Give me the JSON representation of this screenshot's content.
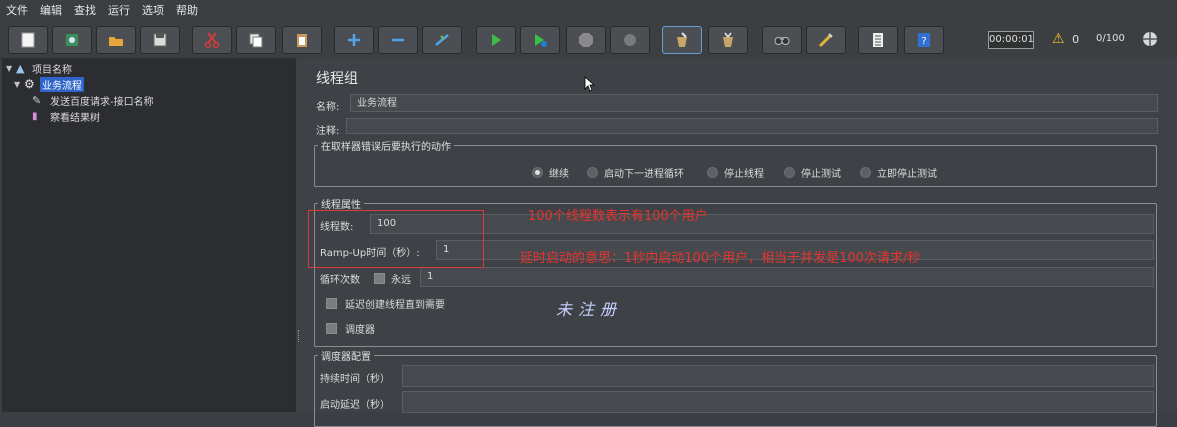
{
  "menu": [
    "文件",
    "编辑",
    "查找",
    "运行",
    "选项",
    "帮助"
  ],
  "toolbar": {
    "timer": "00:00:01",
    "warning_count": "0",
    "threads": "0/100",
    "buttons": [
      "new-icon",
      "templates-icon",
      "open-icon",
      "save-icon",
      "cut-icon",
      "copy-icon",
      "paste-icon",
      "expand-icon",
      "collapse-icon",
      "toggle-icon",
      "start-icon",
      "start-no-pause-icon",
      "stop-icon",
      "shutdown-icon",
      "clear-icon",
      "clear-all-icon",
      "search-icon",
      "reset-search-icon",
      "function-helper-icon",
      "help-icon"
    ]
  },
  "tree": {
    "items": [
      {
        "label": "项目名称",
        "icon": "test-plan-icon"
      },
      {
        "label": "业务流程",
        "icon": "thread-group-gear-icon"
      },
      {
        "label": "发送百度请求-接口名称",
        "icon": "http-sampler-pen-icon"
      },
      {
        "label": "察看结果树",
        "icon": "listener-chart-icon"
      }
    ]
  },
  "panel": {
    "title": "线程组",
    "name_label": "名称:",
    "name_value": "业务流程",
    "comment_label": "注释:",
    "comment_value": "",
    "error_group_title": "在取样器错误后要执行的动作",
    "error_options": [
      "继续",
      "启动下一进程循环",
      "停止线程",
      "停止测试",
      "立即停止测试"
    ],
    "error_selected": "继续",
    "thread_props_title": "线程属性",
    "threads_label": "线程数:",
    "threads_value": "100",
    "rampup_label": "Ramp-Up时间（秒）:",
    "rampup_value": "1",
    "loop_label": "循环次数",
    "forever_label": "永远",
    "loop_value": "1",
    "delay_label": "延迟创建线程直到需要",
    "scheduler_label": "调度器",
    "scheduler_group_title": "调度器配置",
    "duration_label": "持续时间（秒）",
    "startup_delay_label": "启动延迟（秒）"
  },
  "annotations": {
    "note1": "100个线程数表示有100个用户",
    "note2": "延时启动的意思：1秒内启动100个用户，相当于并发是100次请求/秒",
    "handwriting": "未注册"
  },
  "colors": {
    "accent": "#2f65ca",
    "annotation": "#e8342f",
    "background": "#3e4145"
  }
}
